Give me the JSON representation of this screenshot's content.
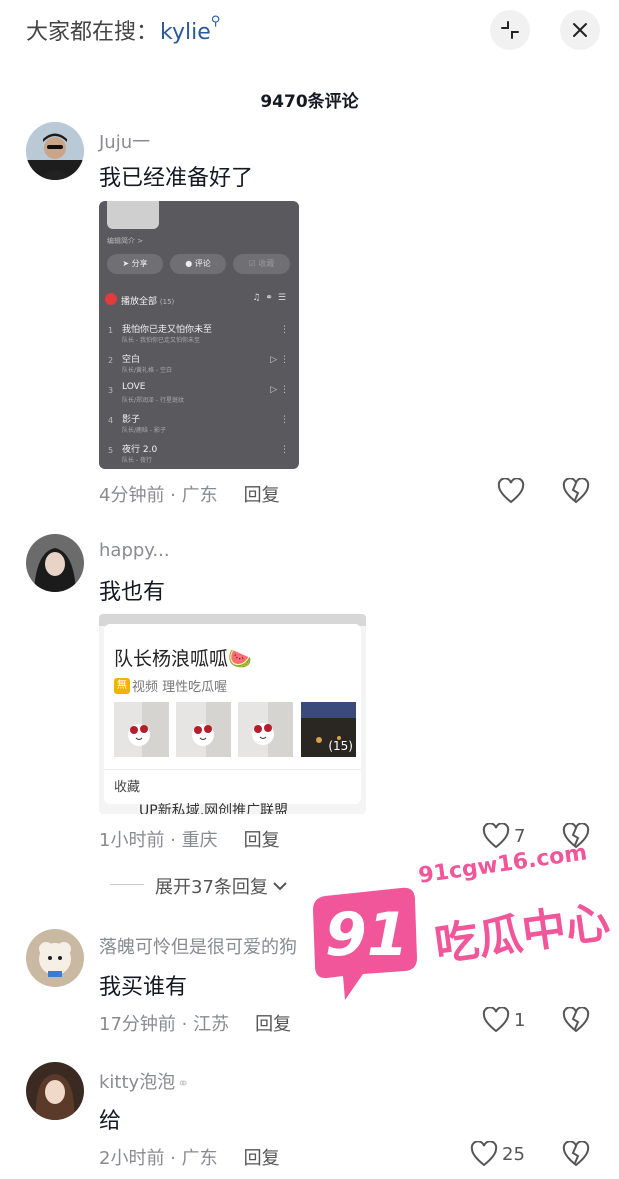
{
  "search": {
    "prefix": "大家都在搜：",
    "keyword": "kylie"
  },
  "comments_count": "9470条评论",
  "comments": [
    {
      "username": "Juju一",
      "text": "我已经准备好了",
      "time": "4分钟前",
      "location": "广东",
      "reply": "回复",
      "likes": "",
      "screenshot": {
        "profile_link": "编辑简介 >",
        "buttons": [
          "分享",
          "评论",
          "收藏"
        ],
        "play_all": "播放全部",
        "play_count": "(15)",
        "songs": [
          {
            "num": "1",
            "title": "我怕你已走又怕你未至",
            "sub": "队长 - 我怕你已走又怕你未至"
          },
          {
            "num": "2",
            "title": "空白",
            "sub": "队长/黄礼格 - 空白"
          },
          {
            "num": "3",
            "title": "LOVE",
            "sub": "队长/郑润泽 - 行星斑纹"
          },
          {
            "num": "4",
            "title": "影子",
            "sub": "队长/鹿晗 - 影子"
          },
          {
            "num": "5",
            "title": "夜行 2.0",
            "sub": "队长 - 夜行"
          }
        ]
      }
    },
    {
      "username": "happy...",
      "text": "我也有",
      "time": "1小时前",
      "location": "重庆",
      "reply": "回复",
      "likes": "7",
      "screenshot": {
        "title": "队长杨浪呱呱",
        "emoji": "🍉",
        "tag": "無",
        "subtitle": "视频 理性吃瓜喔",
        "thumb_count": "(15)",
        "collect": "收藏",
        "bottom_cut": "UP新私域,网创推广联盟"
      },
      "expand": "展开37条回复"
    },
    {
      "username": "落魄可怜但是很可爱的狗",
      "text": "我买谁有",
      "time": "17分钟前",
      "location": "江苏",
      "reply": "回复",
      "likes": "1"
    },
    {
      "username": "kitty泡泡",
      "text": "给",
      "time": "2小时前",
      "location": "广东",
      "reply": "回复",
      "likes": "25"
    }
  ],
  "watermark": {
    "number": "91",
    "url": "91cgw16.com",
    "name": "吃瓜中心"
  },
  "colors": {
    "accent": "#2b5a9c",
    "watermark": "#f2569a",
    "meta": "#8a8b91"
  }
}
